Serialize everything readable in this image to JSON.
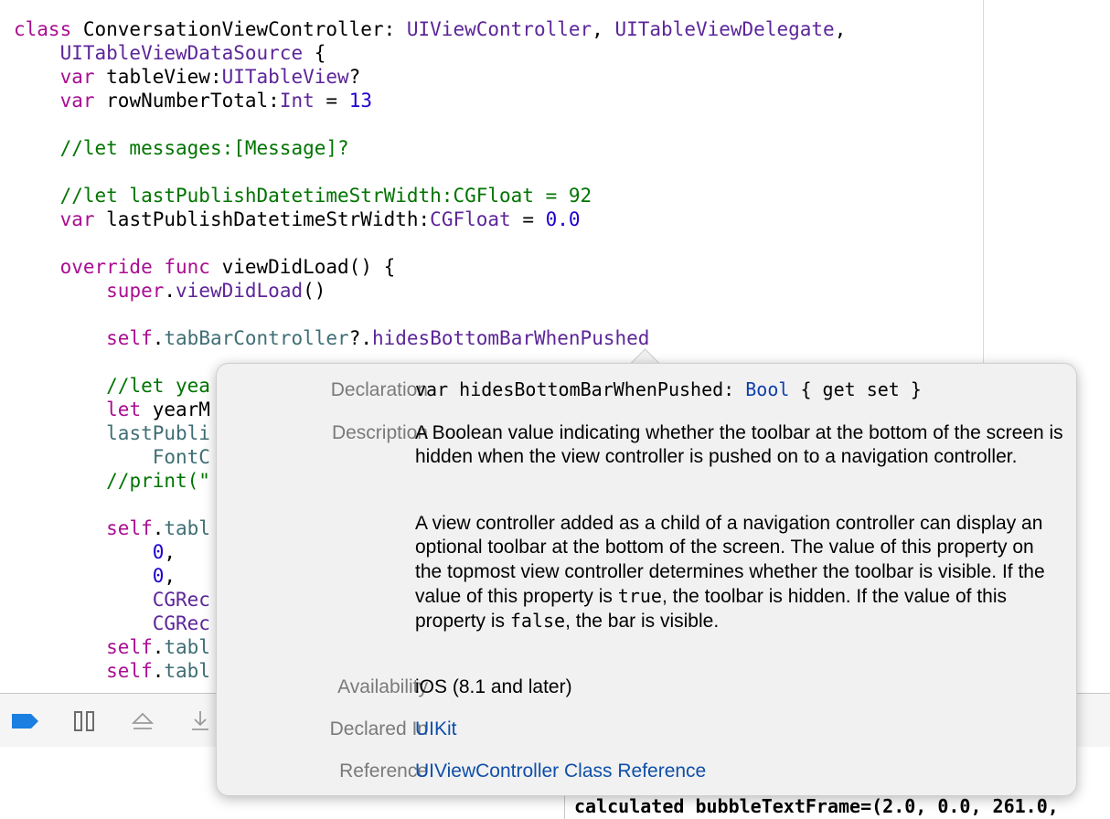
{
  "code": {
    "lines": [
      {
        "segs": [
          [
            "kw",
            "class"
          ],
          [
            "plain",
            " ConversationViewController: "
          ],
          [
            "ty",
            "UIViewController"
          ],
          [
            "plain",
            ", "
          ],
          [
            "ty",
            "UITableViewDelegate"
          ],
          [
            "plain",
            ","
          ]
        ]
      },
      {
        "segs": [
          [
            "plain",
            "    "
          ],
          [
            "ty",
            "UITableViewDataSource"
          ],
          [
            "plain",
            " {"
          ]
        ]
      },
      {
        "segs": [
          [
            "plain",
            "    "
          ],
          [
            "kw",
            "var"
          ],
          [
            "plain",
            " tableView:"
          ],
          [
            "ty",
            "UITableView"
          ],
          [
            "plain",
            "?"
          ]
        ]
      },
      {
        "segs": [
          [
            "plain",
            "    "
          ],
          [
            "kw",
            "var"
          ],
          [
            "plain",
            " rowNumberTotal:"
          ],
          [
            "ty",
            "Int"
          ],
          [
            "plain",
            " = "
          ],
          [
            "num",
            "13"
          ]
        ]
      },
      {
        "segs": []
      },
      {
        "segs": [
          [
            "plain",
            "    "
          ],
          [
            "cm",
            "//let messages:[Message]?"
          ]
        ]
      },
      {
        "segs": []
      },
      {
        "segs": [
          [
            "plain",
            "    "
          ],
          [
            "cm",
            "//let lastPublishDatetimeStrWidth:CGFloat = 92"
          ]
        ]
      },
      {
        "segs": [
          [
            "plain",
            "    "
          ],
          [
            "kw",
            "var"
          ],
          [
            "plain",
            " lastPublishDatetimeStrWidth:"
          ],
          [
            "ty",
            "CGFloat"
          ],
          [
            "plain",
            " = "
          ],
          [
            "num",
            "0.0"
          ]
        ]
      },
      {
        "segs": []
      },
      {
        "segs": [
          [
            "plain",
            "    "
          ],
          [
            "kw",
            "override func"
          ],
          [
            "plain",
            " viewDidLoad() {"
          ]
        ]
      },
      {
        "segs": [
          [
            "plain",
            "        "
          ],
          [
            "kw",
            "super"
          ],
          [
            "plain",
            "."
          ],
          [
            "ty",
            "viewDidLoad"
          ],
          [
            "plain",
            "()"
          ]
        ]
      },
      {
        "segs": []
      },
      {
        "segs": [
          [
            "plain",
            "        "
          ],
          [
            "kw",
            "self"
          ],
          [
            "plain",
            "."
          ],
          [
            "fn",
            "tabBarController"
          ],
          [
            "plain",
            "?."
          ],
          [
            "ty",
            "hidesBottomBarWhenPushed"
          ]
        ]
      },
      {
        "segs": []
      },
      {
        "segs": [
          [
            "plain",
            "        "
          ],
          [
            "cm",
            "//let yea"
          ]
        ]
      },
      {
        "segs": [
          [
            "plain",
            "        "
          ],
          [
            "kw",
            "let"
          ],
          [
            "plain",
            " yearM"
          ]
        ]
      },
      {
        "segs": [
          [
            "plain",
            "        "
          ],
          [
            "fn",
            "lastPubli"
          ]
        ]
      },
      {
        "segs": [
          [
            "plain",
            "            "
          ],
          [
            "fn",
            "FontC"
          ]
        ]
      },
      {
        "segs": [
          [
            "plain",
            "        "
          ],
          [
            "cm",
            "//print(\""
          ]
        ]
      },
      {
        "segs": []
      },
      {
        "segs": [
          [
            "plain",
            "        "
          ],
          [
            "kw",
            "self"
          ],
          [
            "plain",
            "."
          ],
          [
            "fn",
            "tabl"
          ]
        ]
      },
      {
        "segs": [
          [
            "plain",
            "            "
          ],
          [
            "num",
            "0"
          ],
          [
            "plain",
            ","
          ]
        ]
      },
      {
        "segs": [
          [
            "plain",
            "            "
          ],
          [
            "num",
            "0"
          ],
          [
            "plain",
            ","
          ]
        ]
      },
      {
        "segs": [
          [
            "plain",
            "            "
          ],
          [
            "ty",
            "CGRec"
          ]
        ]
      },
      {
        "segs": [
          [
            "plain",
            "            "
          ],
          [
            "ty",
            "CGRec"
          ]
        ]
      },
      {
        "segs": [
          [
            "plain",
            "        "
          ],
          [
            "kw",
            "self"
          ],
          [
            "plain",
            "."
          ],
          [
            "fn",
            "tabl"
          ]
        ]
      },
      {
        "segs": [
          [
            "plain",
            "        "
          ],
          [
            "kw",
            "self"
          ],
          [
            "plain",
            "."
          ],
          [
            "fn",
            "tabl"
          ]
        ]
      }
    ]
  },
  "quick_help": {
    "declaration_label": "Declaration",
    "declaration": {
      "pre": "var hidesBottomBarWhenPushed: ",
      "type": "Bool",
      "post": " { get set }"
    },
    "description_label": "Description",
    "description_p1": "A Boolean value indicating whether the toolbar at the bottom of the screen is hidden when the view controller is pushed on to a navigation controller.",
    "description_p2_a": "A view controller added as a child of a navigation controller can display an optional toolbar at the bottom of the screen. The value of this property on the topmost view controller determines whether the toolbar is visible. If the value of this property is ",
    "description_p2_true": "true",
    "description_p2_b": ", the toolbar is hidden. If the value of this property is ",
    "description_p2_false": "false",
    "description_p2_c": ", the bar is visible.",
    "availability_label": "Availability",
    "availability": "iOS (8.1 and later)",
    "declared_in_label": "Declared In",
    "declared_in": "UIKit",
    "reference_label": "Reference",
    "reference": "UIViewController Class Reference"
  },
  "debug_bar": {
    "icons": [
      "breakpoint-toggle-icon",
      "pause-icon",
      "step-over-icon",
      "step-into-icon"
    ],
    "breakpoint_color": "#1a7fe0"
  },
  "console": {
    "output": "calculated bubbleTextFrame=(2.0, 0.0, 261.0,"
  },
  "colors": {
    "keyword": "#aa0d91",
    "type": "#5c2699",
    "number": "#1c00cf",
    "comment": "#007400",
    "link": "#0e4fa8"
  }
}
